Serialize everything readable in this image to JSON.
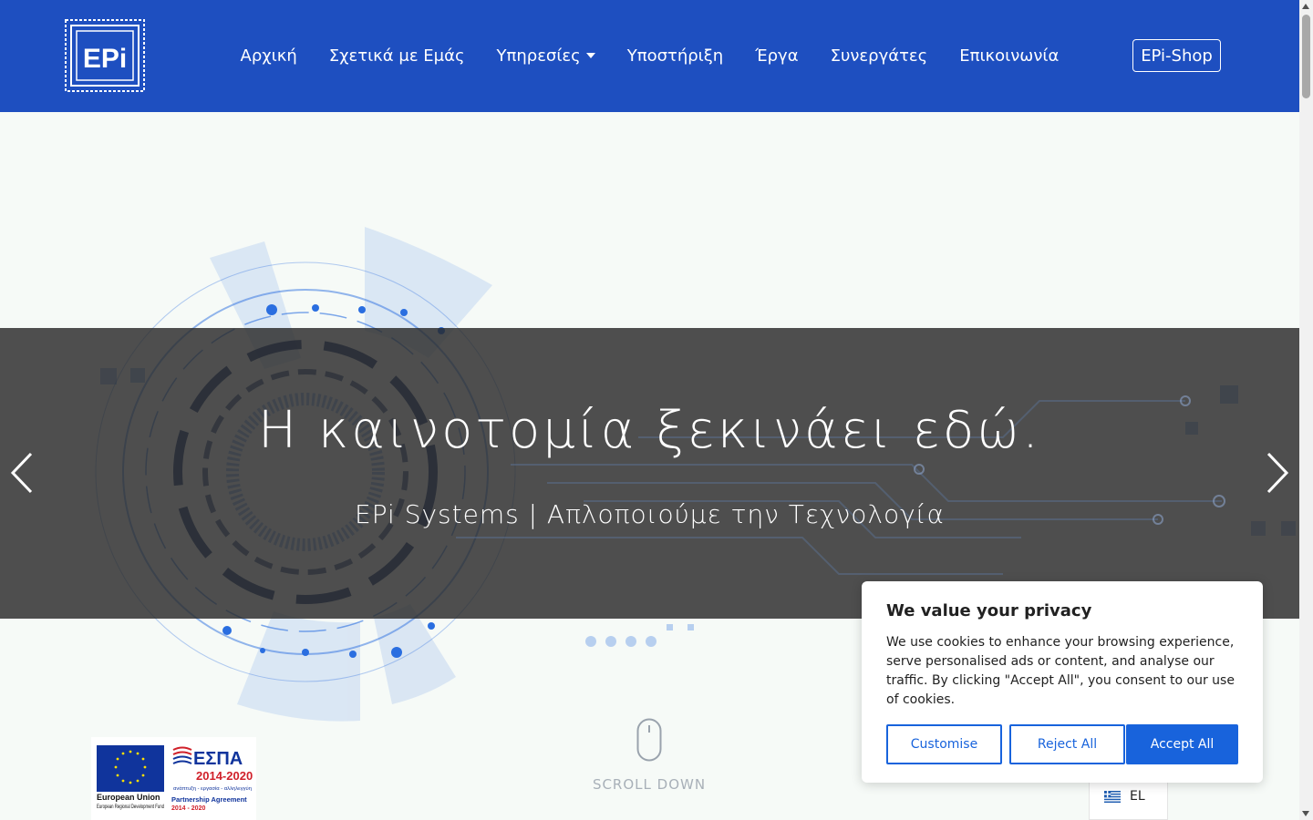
{
  "header": {
    "logo_text": "EPi",
    "nav": [
      {
        "label": "Αρχική"
      },
      {
        "label": "Σχετικά με Εμάς"
      },
      {
        "label": "Υπηρεσίες"
      },
      {
        "label": "Υποστήριξη"
      },
      {
        "label": "Έργα"
      },
      {
        "label": "Συνεργάτες"
      },
      {
        "label": "Επικοινωνία"
      }
    ],
    "shop_label": "EPi-Shop"
  },
  "hero": {
    "title": "Η καινοτομία ξεκινάει εδώ.",
    "subtitle": "EPi Systems | Απλοποιούμε την Τεχνολογία",
    "scroll_label": "SCROLL DOWN"
  },
  "espa": {
    "eu_title": "European Union",
    "eu_fund": "European Regional Development Fund",
    "espa_title": "ΕΣΠΑ",
    "espa_years": "2014-2020",
    "espa_slogan": "ανάπτυξη - εργασία - αλληλεγγύη",
    "agreement": "Partnership Agreement",
    "agreement_years": "2014 - 2020"
  },
  "cookie": {
    "title": "We value your privacy",
    "text": "We use cookies to enhance your browsing experience, serve personalised ads or content, and analyse our traffic. By clicking \"Accept All\", you consent to our use of cookies.",
    "customise": "Customise",
    "reject": "Reject All",
    "accept": "Accept All"
  },
  "language": {
    "code": "EL"
  },
  "colors": {
    "navbar": "#1e4fc0",
    "cookie_accent": "#1863dc",
    "hero_art": "#1f5fd6"
  }
}
